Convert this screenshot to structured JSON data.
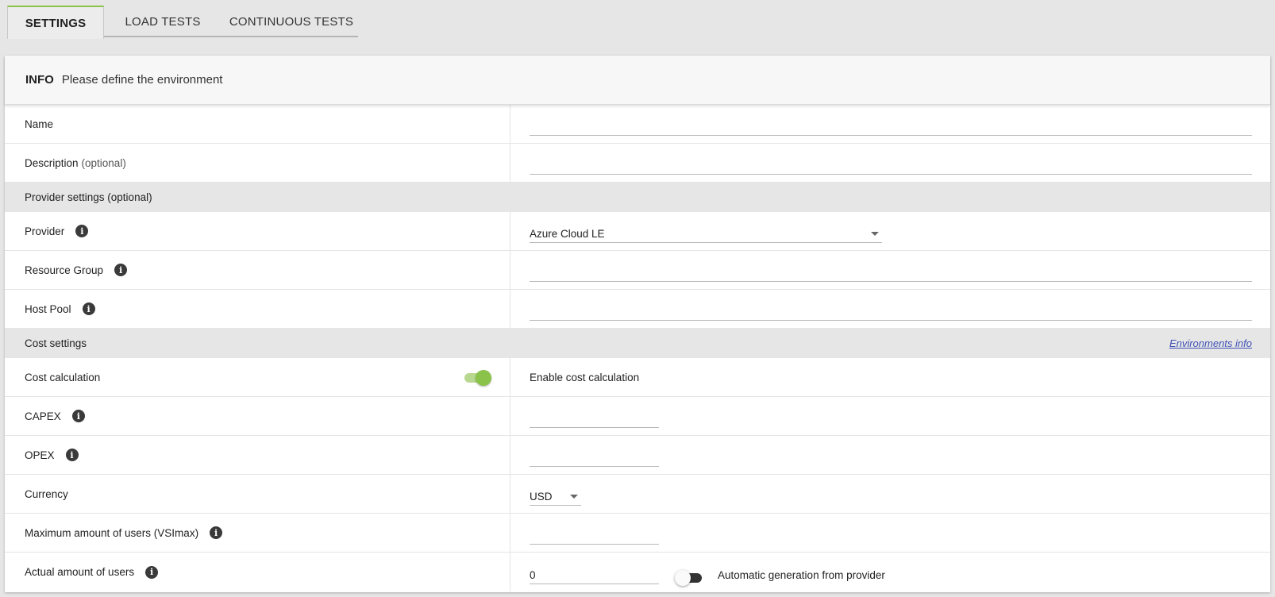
{
  "tabs": [
    {
      "label": "SETTINGS",
      "active": true
    },
    {
      "label": "LOAD TESTS",
      "active": false
    },
    {
      "label": "CONTINUOUS TESTS",
      "active": false
    }
  ],
  "info": {
    "title": "INFO",
    "subtitle": "Please define the environment"
  },
  "fields": {
    "name": {
      "label": "Name",
      "value": ""
    },
    "description": {
      "label": "Description",
      "optional": "(optional)",
      "value": ""
    }
  },
  "provider_section": {
    "title": "Provider settings (optional)"
  },
  "provider": {
    "provider": {
      "label": "Provider",
      "value": "Azure Cloud LE"
    },
    "resource_group": {
      "label": "Resource Group",
      "value": ""
    },
    "host_pool": {
      "label": "Host Pool",
      "value": ""
    }
  },
  "cost_section": {
    "title": "Cost settings",
    "link": "Environments info"
  },
  "cost": {
    "cost_calculation": {
      "label": "Cost calculation",
      "toggle_label": "Enable cost calculation",
      "enabled": true
    },
    "capex": {
      "label": "CAPEX",
      "value": ""
    },
    "opex": {
      "label": "OPEX",
      "value": ""
    },
    "currency": {
      "label": "Currency",
      "value": "USD"
    },
    "vsimax": {
      "label": "Maximum amount of users (VSImax)",
      "value": ""
    },
    "actual_users": {
      "label": "Actual amount of users",
      "value": "0",
      "auto_label": "Automatic generation from provider",
      "auto_enabled": false
    }
  },
  "colors": {
    "accent": "#8bc34a",
    "link": "#3f51b5"
  },
  "icons": {
    "info": "info-icon",
    "dropdown": "chevron-down-icon"
  }
}
